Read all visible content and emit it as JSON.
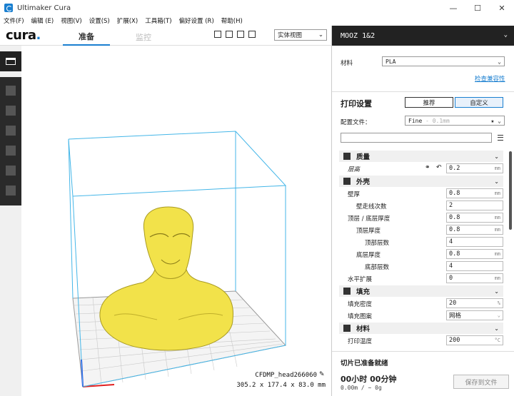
{
  "window": {
    "title": "Ultimaker Cura"
  },
  "menu": [
    "文件(F)",
    "编辑 (E)",
    "视图(V)",
    "设置(S)",
    "扩展(X)",
    "工具箱(T)",
    "偏好设置 (R)",
    "帮助(H)"
  ],
  "header": {
    "logo": "cura",
    "tabs": {
      "prepare": "准备",
      "monitor": "监控"
    },
    "view_select": "实体视图"
  },
  "viewport": {
    "job_name": "CFDMP_head266060",
    "dimensions": "305.2 x 177.4 x 83.0 mm"
  },
  "panel": {
    "printer": "MOOZ 1&2",
    "material_label": "材料",
    "material_value": "PLA",
    "compat_link": "检查兼容性",
    "print_settings": "打印设置",
    "mode_recommended": "推荐",
    "mode_custom": "自定义",
    "profile_label": "配置文件：",
    "profile_value": "Fine",
    "profile_hint": "- 0.1mm",
    "categories": {
      "quality": "质量",
      "shell": "外壳",
      "infill": "填充",
      "material": "材料"
    },
    "rows": {
      "layer_height": {
        "label": "层高",
        "value": "0.2",
        "unit": "mm"
      },
      "wall_thickness": {
        "label": "壁厚",
        "value": "0.8",
        "unit": "mm"
      },
      "wall_line_count": {
        "label": "壁走线次数",
        "value": "2",
        "unit": ""
      },
      "top_bottom_thickness": {
        "label": "顶层 / 底层厚度",
        "value": "0.8",
        "unit": "mm"
      },
      "top_thickness": {
        "label": "顶层厚度",
        "value": "0.8",
        "unit": "mm"
      },
      "top_layers": {
        "label": "顶部层数",
        "value": "4",
        "unit": ""
      },
      "bottom_thickness": {
        "label": "底层厚度",
        "value": "0.8",
        "unit": "mm"
      },
      "bottom_layers": {
        "label": "底部层数",
        "value": "4",
        "unit": ""
      },
      "horizontal_expansion": {
        "label": "水平扩展",
        "value": "0",
        "unit": "mm"
      },
      "infill_density": {
        "label": "填充密度",
        "value": "20",
        "unit": "%"
      },
      "infill_pattern": {
        "label": "填充图案",
        "value": "网格",
        "unit": ""
      },
      "print_temp": {
        "label": "打印温度",
        "value": "200",
        "unit": "°C"
      }
    },
    "slice_status": "切片已准备就绪",
    "time": "00小时 00分钟",
    "usage": "0.00m / ~ 0g",
    "save_button": "保存到文件"
  },
  "colors": {
    "accent": "#1a7fd0",
    "model": "#f2e24a",
    "printer_bar": "#222222"
  }
}
